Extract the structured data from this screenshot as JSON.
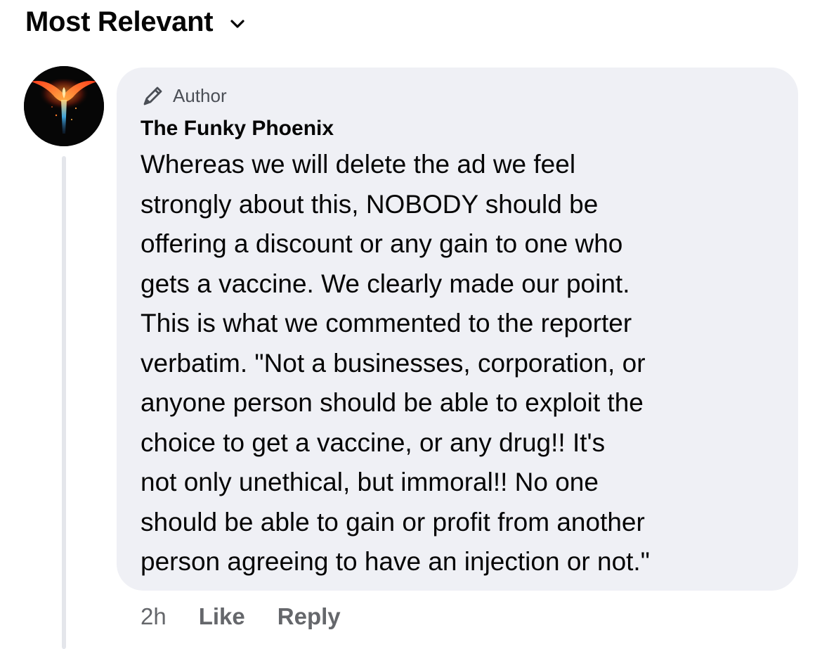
{
  "comments_header": {
    "sort_label": "Most Relevant",
    "sort_icon": "chevron-down-icon"
  },
  "comment": {
    "avatar_icon": "phoenix-avatar",
    "badge": {
      "icon": "pencil-icon",
      "label": "Author"
    },
    "author_name": "The Funky Phoenix",
    "text": "Whereas we will delete the ad we feel\nstrongly about this, NOBODY should be\noffering a discount or any gain to one who\ngets a vaccine. We clearly made our point.\nThis is what we commented to the reporter\nverbatim. \"Not a businesses, corporation, or\nanyone person should be able to exploit the\nchoice to get a vaccine, or any drug!! It's\nnot only unethical, but immoral!! No one\nshould be able to gain or profit from another\nperson agreeing to have an injection or not.\"",
    "timestamp": "2h",
    "like_label": "Like",
    "reply_label": "Reply"
  },
  "colors": {
    "bubble_background": "#eff0f5",
    "secondary_text": "#65676b",
    "primary_text": "#050505"
  }
}
